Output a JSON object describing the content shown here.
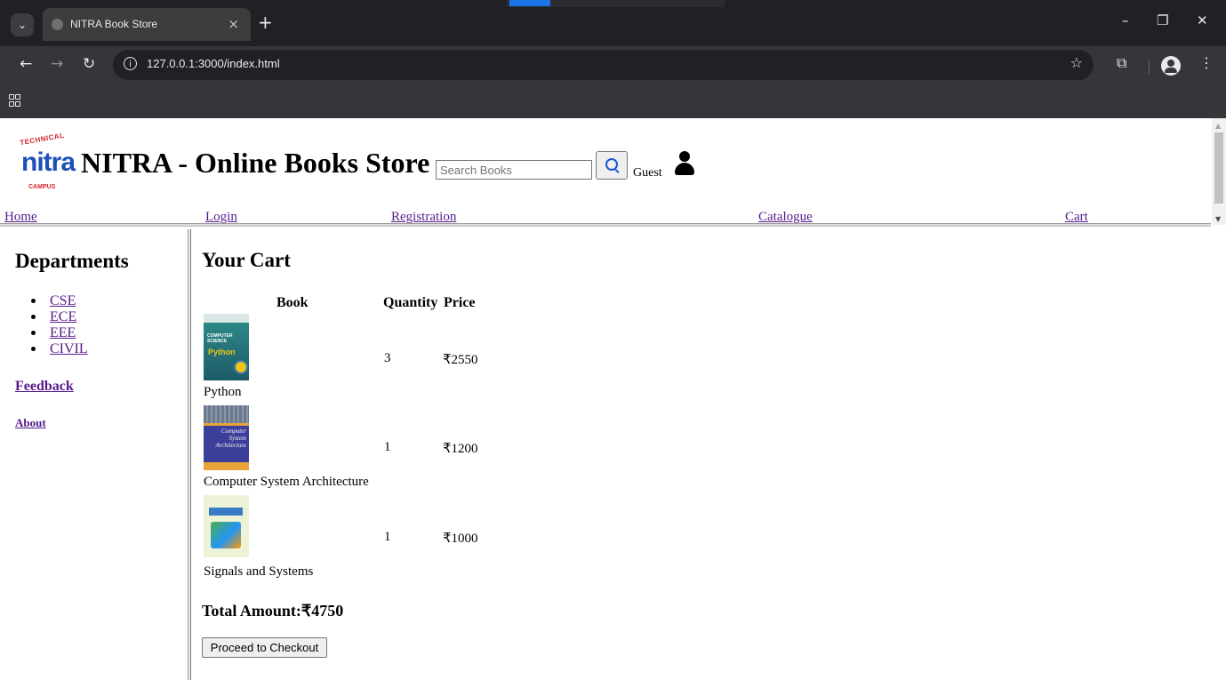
{
  "browser": {
    "tab_title": "NITRA Book Store",
    "tab_close": "×",
    "new_tab": "+",
    "url": "127.0.0.1:3000/index.html",
    "window_controls": [
      "–",
      "❐",
      "✕"
    ]
  },
  "header": {
    "logo": {
      "top_arc": "TECHNICAL",
      "word": "nitra",
      "bottom_arc": "CAMPUS"
    },
    "site_title": "NITRA - Online Books Store",
    "search_placeholder": "Search Books",
    "user_label": "Guest"
  },
  "nav": {
    "items": [
      {
        "label": "Home"
      },
      {
        "label": "Login"
      },
      {
        "label": "Registration"
      },
      {
        "label": "Catalogue"
      },
      {
        "label": "Cart"
      }
    ]
  },
  "sidebar": {
    "title": "Departments",
    "departments": [
      "CSE",
      "ECE",
      "EEE",
      "CIVIL"
    ],
    "feedback": "Feedback",
    "about": "About"
  },
  "cart": {
    "title": "Your Cart",
    "columns": [
      "Book",
      "Quantity",
      "Price"
    ],
    "items": [
      {
        "book": "Python",
        "quantity": "3",
        "price": "₹2550",
        "cover": {
          "title_lines": "COMPUTER\nSCIENCE",
          "sub": "Python"
        }
      },
      {
        "book": "Computer System Architecture",
        "quantity": "1",
        "price": "₹1200",
        "cover": {
          "title_lines": "Computer\nSystem\nArchitecture"
        }
      },
      {
        "book": "Signals and Systems",
        "quantity": "1",
        "price": "₹1000"
      }
    ],
    "total_label": "Total Amount:₹4750",
    "checkout_label": "Proceed to Checkout"
  }
}
